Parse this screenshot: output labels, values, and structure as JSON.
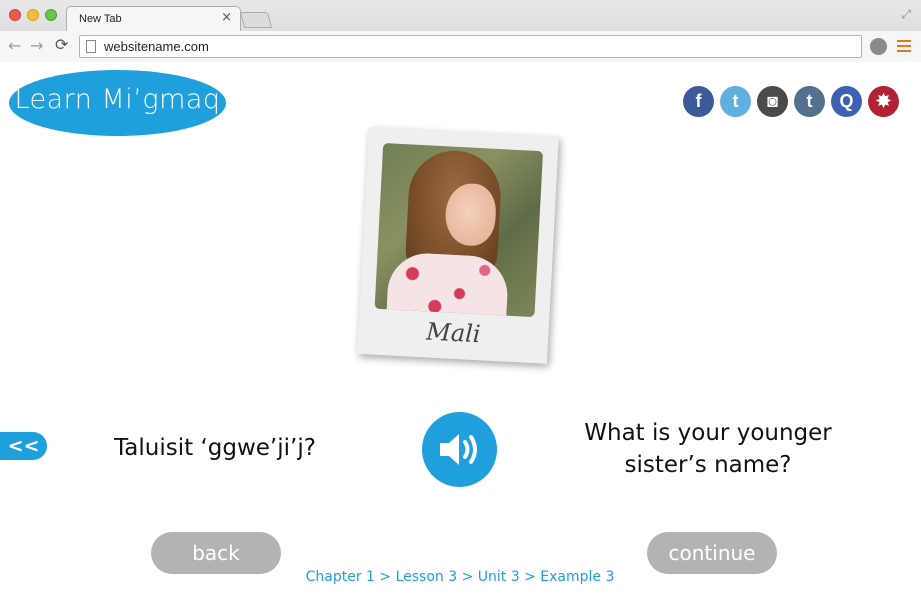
{
  "browser": {
    "tab_title": "New Tab",
    "tab_close": "×",
    "url": "websitename.com"
  },
  "logo": {
    "text": "Learn Mi’gmaq"
  },
  "social": [
    {
      "icon": "facebook-icon",
      "glyph": "f",
      "color": "#3c5a99"
    },
    {
      "icon": "twitter-icon",
      "glyph": "t",
      "color": "#5fb0e0"
    },
    {
      "icon": "instagram-icon",
      "glyph": "◙",
      "color": "#4a4a4a"
    },
    {
      "icon": "tumblr-icon",
      "glyph": "t",
      "color": "#54708f"
    },
    {
      "icon": "quora-icon",
      "glyph": "Q",
      "color": "#3d62b4"
    },
    {
      "icon": "star-emblem-icon",
      "glyph": "✸",
      "color": "#b22134"
    }
  ],
  "photo": {
    "caption": "Mali"
  },
  "lesson": {
    "prev_arrow": "<<",
    "mikmaq_phrase": "Taluisit ‘ggwe’ji’j?",
    "english_phrase_line1": "What is your younger",
    "english_phrase_line2": "sister’s name?"
  },
  "buttons": {
    "back": "back",
    "continue": "continue"
  },
  "breadcrumb": "Chapter 1 > Lesson 3 > Unit 3 > Example 3",
  "colors": {
    "accent": "#1fa0dd",
    "button_gray": "#b3b3b3"
  }
}
